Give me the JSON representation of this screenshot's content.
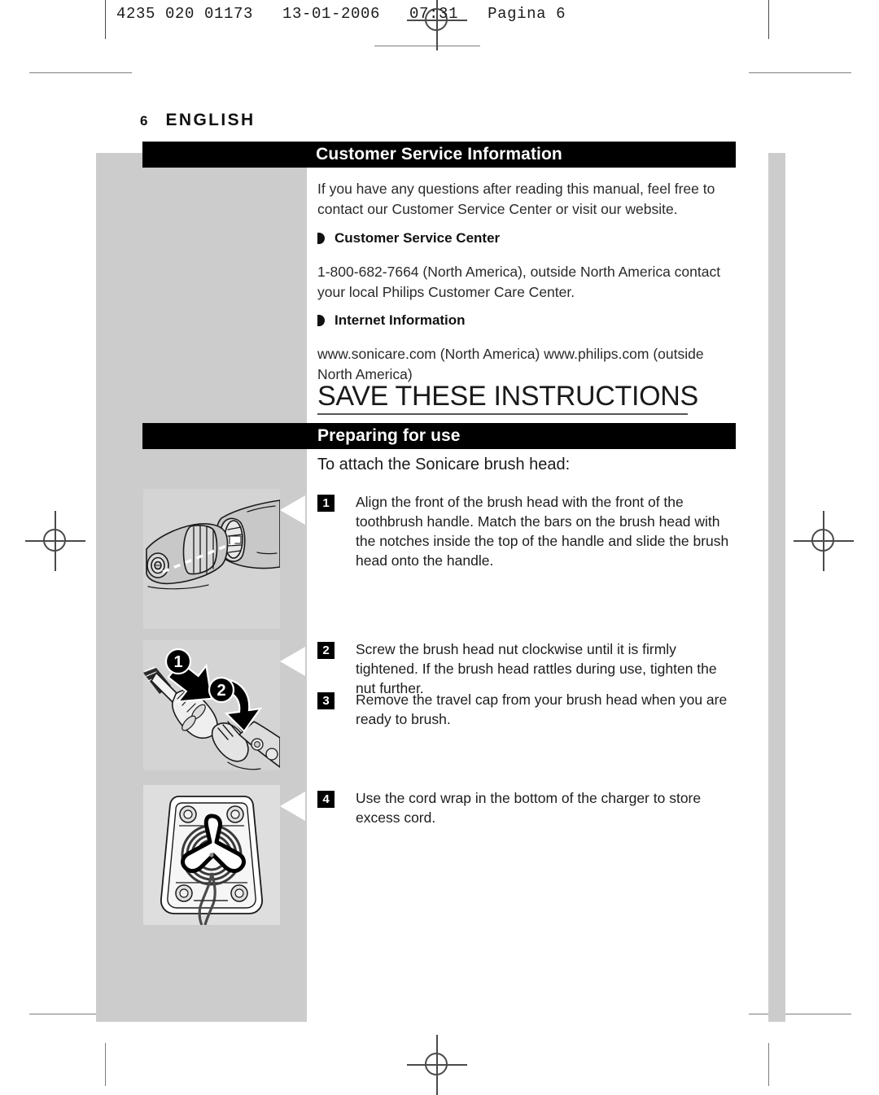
{
  "scan_header": "4235 020 01173   13-01-2006   07:31   Pagina 6",
  "running_head": {
    "folio": "6",
    "language": "ENGLISH"
  },
  "sections": {
    "customer_service": {
      "banner": "Customer Service Information",
      "intro": "If you have any questions after reading this manual, feel free to contact our Customer Service Center or visit our website.",
      "subheads": [
        {
          "label": "Customer Service Center",
          "body": "1-800-682-7664 (North America), outside North America contact your local Philips Customer Care Center."
        },
        {
          "label": "Internet Information",
          "body": "www.sonicare.com (North America) www.philips.com (outside North America)"
        }
      ],
      "callout": "SAVE THESE INSTRUCTIONS"
    },
    "preparing": {
      "banner": "Preparing for use",
      "lead_in": "To attach the Sonicare brush head:",
      "steps": [
        {
          "number": "1",
          "text": "Align the front of the brush head with the front of the toothbrush handle. Match the bars on the brush head with the notches inside the top of the handle and slide the brush head onto the handle."
        },
        {
          "number": "2",
          "text": "Screw the brush head nut clockwise until it is firmly tightened. If the brush head rattles during use, tighten the nut further."
        },
        {
          "number": "3",
          "text": "Remove the travel cap from your brush head when you are ready to brush."
        },
        {
          "number": "4",
          "text": "Use the cord wrap in the bottom of the charger to store excess cord."
        }
      ]
    }
  },
  "figures": [
    {
      "name": "brush-head-alignment",
      "callouts": []
    },
    {
      "name": "brush-head-attach-arrows",
      "callouts": [
        "1",
        "2"
      ]
    },
    {
      "name": "charger-cord-wrap",
      "callouts": []
    }
  ],
  "colors": {
    "banner_bg": "#000000",
    "banner_text": "#ffffff",
    "panel_gray": "#cccccc",
    "figure_gray": "#d4d4d4",
    "body_text": "#2a2a2a"
  }
}
